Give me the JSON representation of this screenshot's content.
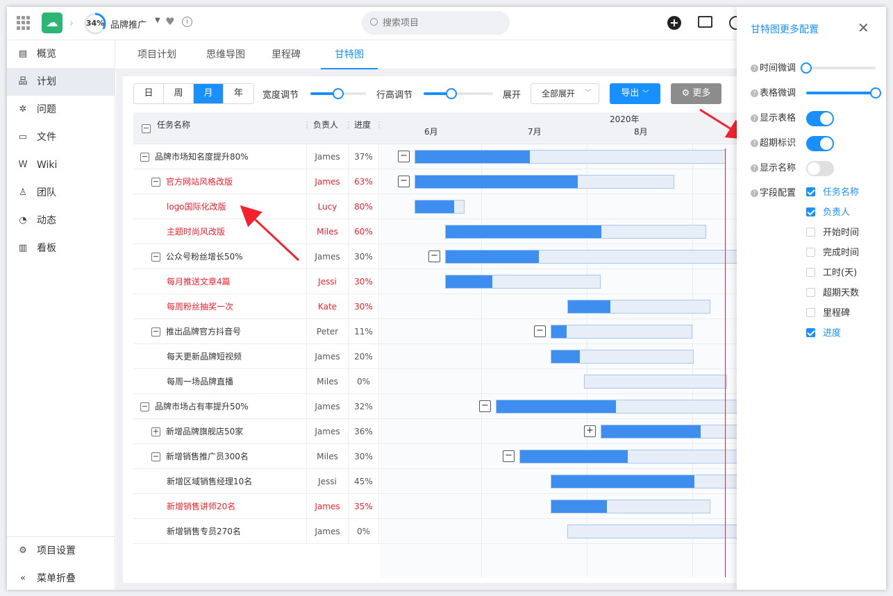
{
  "header": {
    "progress_label": "34%",
    "progress": 0.34,
    "project_name": "品牌推广",
    "search_placeholder": "搜索项目"
  },
  "sidebar": {
    "items": [
      {
        "label": "概览",
        "icon": "overview-icon",
        "glyph": "▤"
      },
      {
        "label": "计划",
        "icon": "plan-icon",
        "glyph": "品",
        "active": true
      },
      {
        "label": "问题",
        "icon": "bug-icon",
        "glyph": "✲"
      },
      {
        "label": "文件",
        "icon": "folder-icon",
        "glyph": "▭"
      },
      {
        "label": "Wiki",
        "icon": "wiki-icon",
        "glyph": "W"
      },
      {
        "label": "团队",
        "icon": "team-icon",
        "glyph": "♙"
      },
      {
        "label": "动态",
        "icon": "activity-icon",
        "glyph": "◔"
      },
      {
        "label": "看板",
        "icon": "board-icon",
        "glyph": "▥"
      }
    ],
    "settings_label": "项目设置",
    "collapse_label": "菜单折叠"
  },
  "tabs": [
    "项目计划",
    "思维导图",
    "里程碑",
    "甘特图"
  ],
  "active_tab": 3,
  "toolbar": {
    "scales": [
      "日",
      "周",
      "月",
      "年"
    ],
    "active_scale": 2,
    "width_label": "宽度调节",
    "width_value": 0.5,
    "height_label": "行高调节",
    "height_value": 0.4,
    "expand_label": "展开",
    "expand_select": "全部展开",
    "export_label": "导出",
    "more_label": "更多"
  },
  "table": {
    "col_name": "任务名称",
    "col_owner": "负责人",
    "col_progress": "进度",
    "year": "2020年",
    "months": [
      "6月",
      "7月",
      "8月"
    ]
  },
  "rows": [
    {
      "name": "品牌市场知名度提升80%",
      "owner": "James",
      "progress": "37%",
      "level": 0,
      "toggle": "−",
      "red": false
    },
    {
      "name": "官方网站风格改版",
      "owner": "James",
      "progress": "63%",
      "level": 1,
      "toggle": "−",
      "red": true
    },
    {
      "name": "logo国际化改版",
      "owner": "Lucy",
      "progress": "80%",
      "level": 2,
      "toggle": "",
      "red": true
    },
    {
      "name": "主题时尚风改版",
      "owner": "Miles",
      "progress": "60%",
      "level": 2,
      "toggle": "",
      "red": true
    },
    {
      "name": "公众号粉丝增长50%",
      "owner": "James",
      "progress": "30%",
      "level": 1,
      "toggle": "−",
      "red": false
    },
    {
      "name": "每月推送文章4篇",
      "owner": "Jessi",
      "progress": "30%",
      "level": 2,
      "toggle": "",
      "red": true
    },
    {
      "name": "每周粉丝抽奖一次",
      "owner": "Kate",
      "progress": "30%",
      "level": 2,
      "toggle": "",
      "red": true
    },
    {
      "name": "推出品牌官方抖音号",
      "owner": "Peter",
      "progress": "11%",
      "level": 1,
      "toggle": "−",
      "red": false
    },
    {
      "name": "每天更新品牌短视频",
      "owner": "James",
      "progress": "20%",
      "level": 2,
      "toggle": "",
      "red": false
    },
    {
      "name": "每周一场品牌直播",
      "owner": "Miles",
      "progress": "0%",
      "level": 2,
      "toggle": "",
      "red": false
    },
    {
      "name": "品牌市场占有率提升50%",
      "owner": "James",
      "progress": "32%",
      "level": 0,
      "toggle": "−",
      "red": false
    },
    {
      "name": "新增品牌旗舰店50家",
      "owner": "James",
      "progress": "36%",
      "level": 1,
      "toggle": "+",
      "red": false
    },
    {
      "name": "新增销售推广员300名",
      "owner": "Miles",
      "progress": "30%",
      "level": 1,
      "toggle": "−",
      "red": false
    },
    {
      "name": "新增区域销售经理10名",
      "owner": "Jessi",
      "progress": "45%",
      "level": 2,
      "toggle": "",
      "red": false
    },
    {
      "name": "新增销售讲师20名",
      "owner": "James",
      "progress": "35%",
      "level": 2,
      "toggle": "",
      "red": true
    },
    {
      "name": "新增销售专员270名",
      "owner": "James",
      "progress": "0%",
      "level": 2,
      "toggle": "",
      "red": false
    }
  ],
  "panel": {
    "title": "甘特图更多配置",
    "time_adjust_label": "时间微调",
    "time_adjust_value": 0.0,
    "table_adjust_label": "表格微调",
    "table_adjust_value": 1.0,
    "show_table_label": "显示表格",
    "show_table": true,
    "overdue_label": "超期标识",
    "overdue": true,
    "show_name_label": "显示名称",
    "show_name": false,
    "fields_label": "字段配置",
    "fields": [
      {
        "label": "任务名称",
        "checked": true
      },
      {
        "label": "负责人",
        "checked": true
      },
      {
        "label": "开始时间",
        "checked": false
      },
      {
        "label": "完成时间",
        "checked": false
      },
      {
        "label": "工时(天)",
        "checked": false
      },
      {
        "label": "超期天数",
        "checked": false
      },
      {
        "label": "里程碑",
        "checked": false
      },
      {
        "label": "进度",
        "checked": true
      }
    ]
  },
  "colors": {
    "accent": "#1890ff",
    "bar": "#3d8eee",
    "overdue": "#f5222d"
  }
}
